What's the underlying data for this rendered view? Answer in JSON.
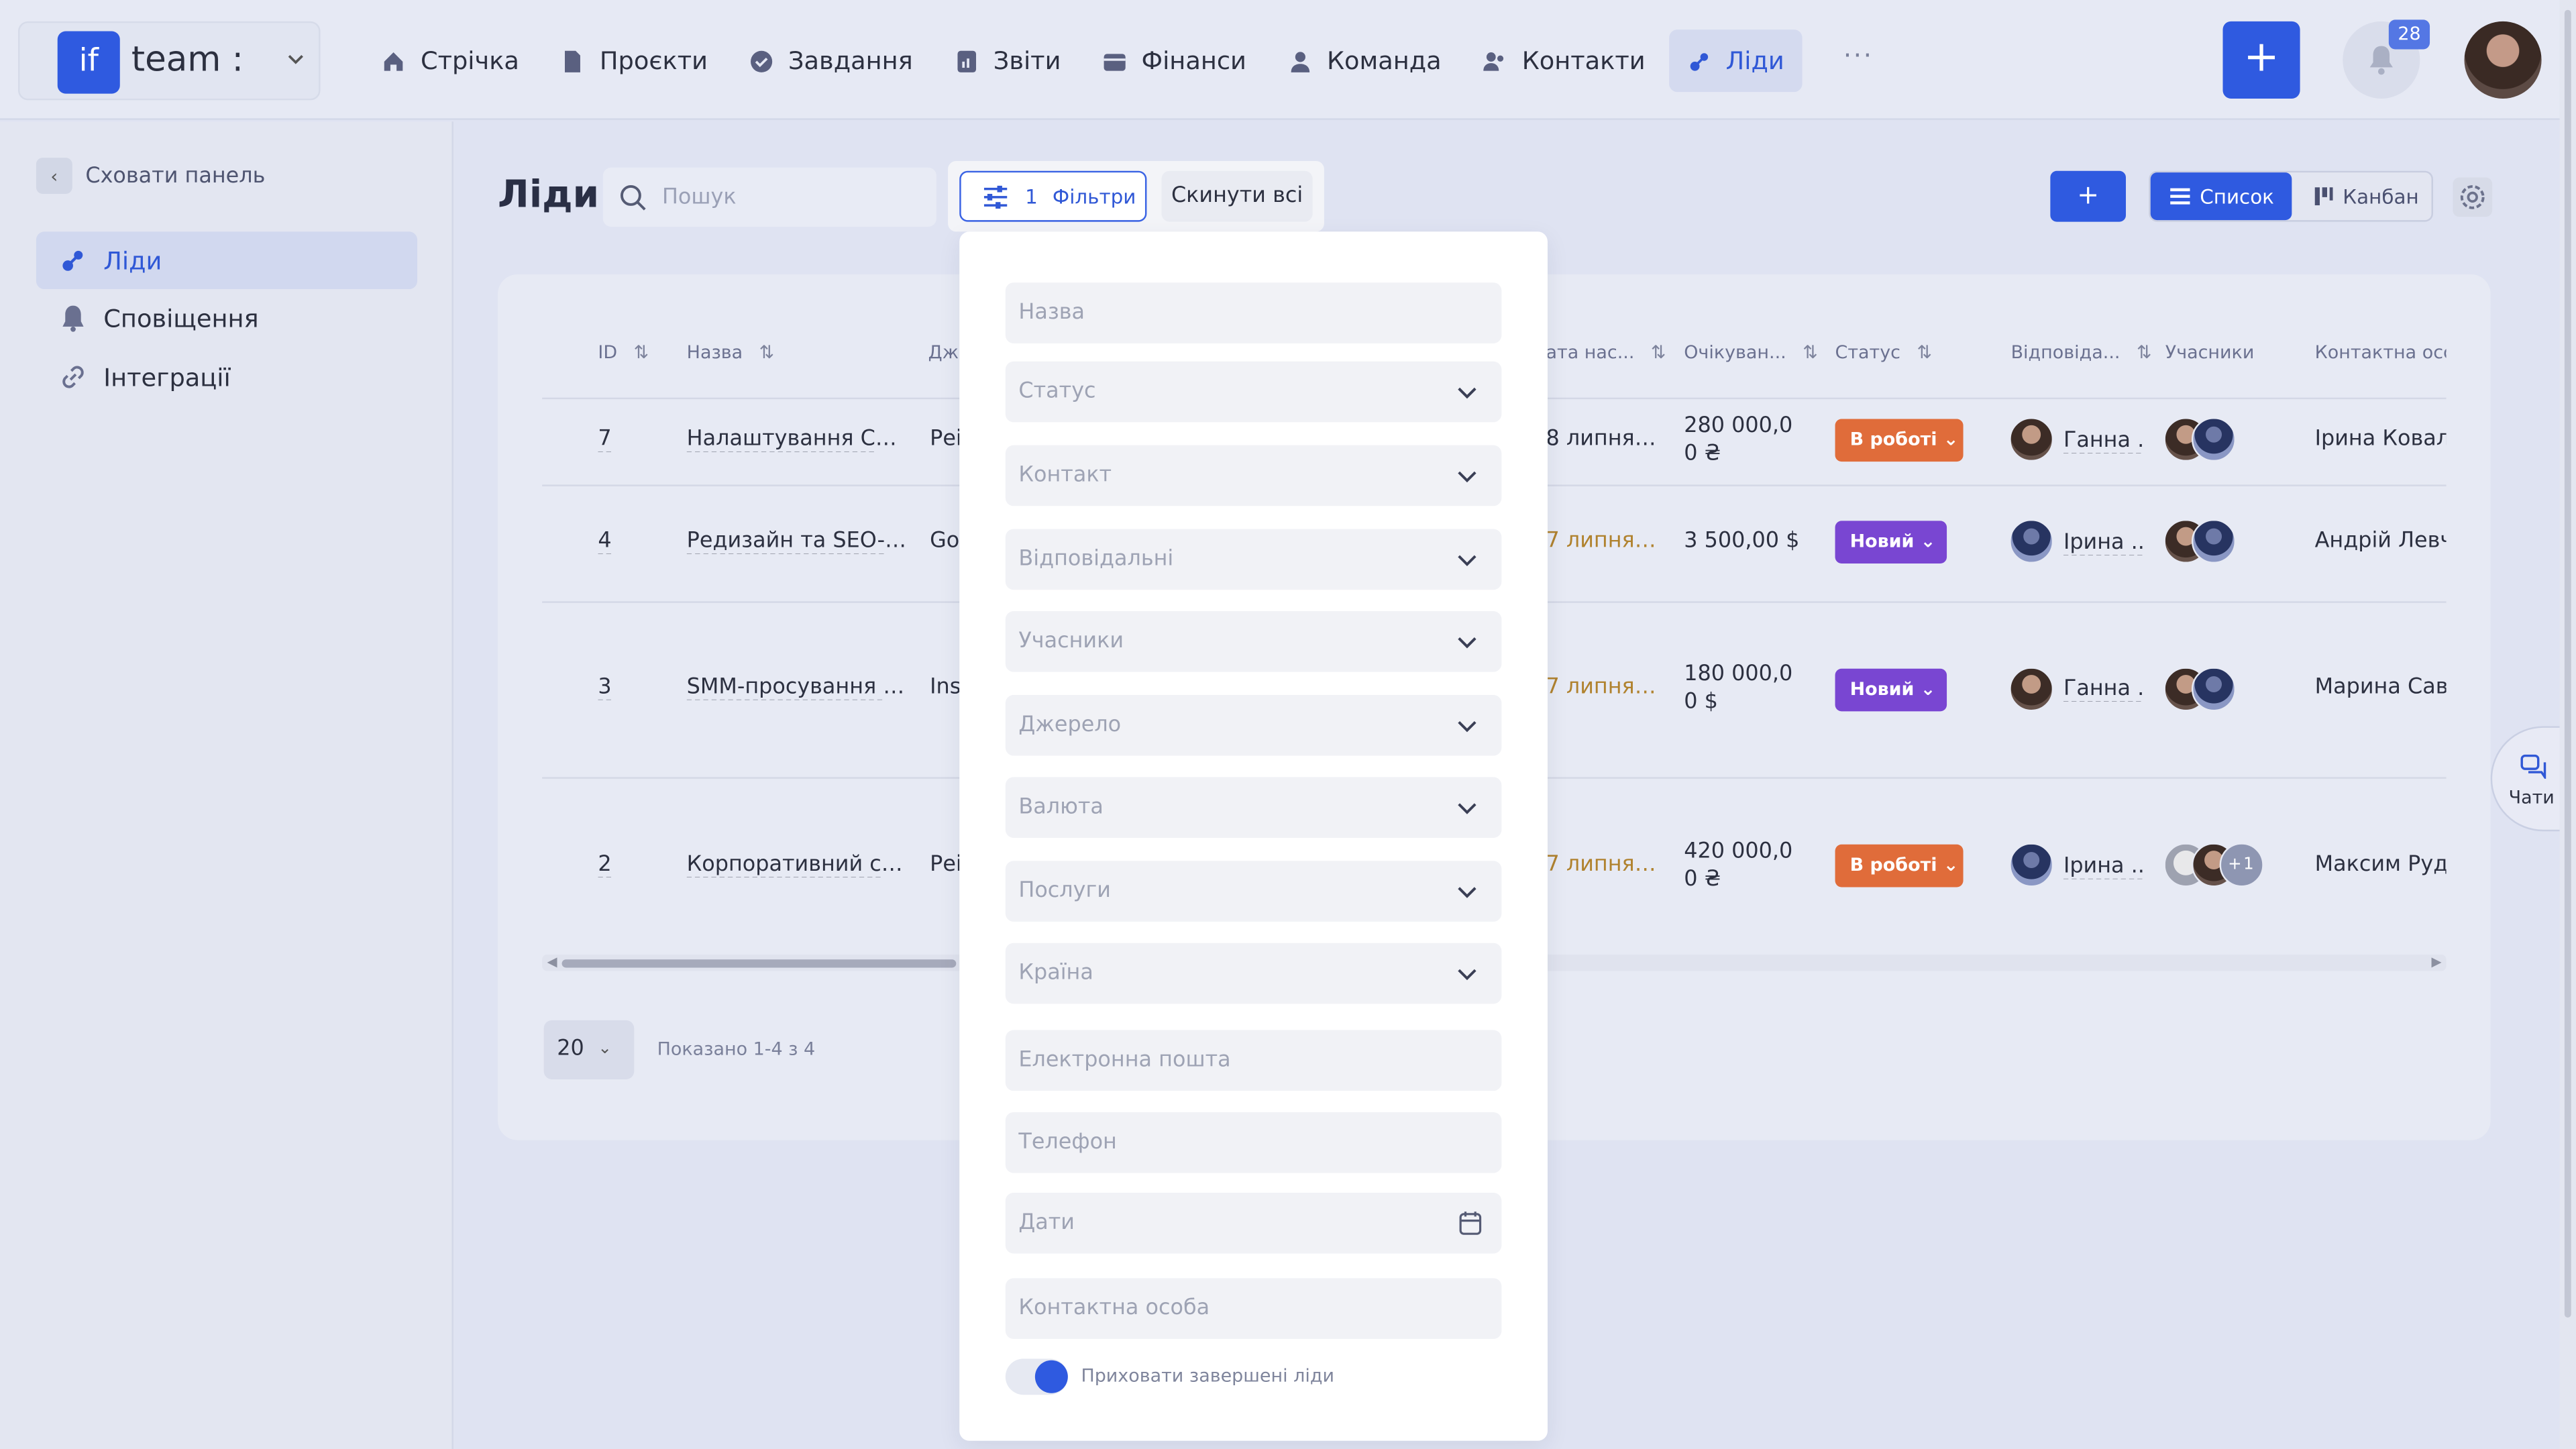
{
  "brand": {
    "logo": "if",
    "name": "team :"
  },
  "nav": [
    {
      "label": "Стрічка",
      "icon": "home-icon"
    },
    {
      "label": "Проєкти",
      "icon": "file-icon"
    },
    {
      "label": "Завдання",
      "icon": "check-circle-icon"
    },
    {
      "label": "Звіти",
      "icon": "report-icon"
    },
    {
      "label": "Фінанси",
      "icon": "wallet-icon"
    },
    {
      "label": "Команда",
      "icon": "person-icon"
    },
    {
      "label": "Контакти",
      "icon": "contacts-icon"
    },
    {
      "label": "Ліди",
      "icon": "leads-icon",
      "active": true
    }
  ],
  "header": {
    "more": "···",
    "add": "+",
    "notifications_count": "28"
  },
  "sidebar": {
    "hide_label": "Сховати панель",
    "items": [
      {
        "label": "Ліди",
        "icon": "leads-icon",
        "active": true
      },
      {
        "label": "Сповіщення",
        "icon": "bell-icon"
      },
      {
        "label": "Інтеграції",
        "icon": "link-icon"
      }
    ]
  },
  "toolbar": {
    "title": "Ліди",
    "search_placeholder": "Пошук",
    "filter_count": "1",
    "filter_label": "Фільтри",
    "reset_label": "Скинути всі",
    "add_label": "+",
    "view_list": "Список",
    "view_kanban": "Канбан"
  },
  "table": {
    "columns": [
      "ID",
      "Назва",
      "Дж",
      "ата нас...",
      "Очікуван...",
      "Статус",
      "Відповіда...",
      "Учасники",
      "Контактна осо"
    ],
    "rows": [
      {
        "id": "7",
        "name": "Налаштування CRM ...",
        "source": "Реі",
        "date": "8 липня, ...",
        "amount1": "280 000,0",
        "amount2": "0 ₴",
        "status": "В роботі",
        "resp": "Ганна ...",
        "contact": "Ірина Коваль"
      },
      {
        "id": "4",
        "name": "Редизайн та SEO-оп...",
        "source": "Goo",
        "date": "7 липня, 2...",
        "amount1": "3 500,00 $",
        "amount2": "",
        "status": "Новий",
        "resp": "Ірина ...",
        "contact": "Андрій Левче"
      },
      {
        "id": "3",
        "name": "SMM-просування ст...",
        "source": "Ins",
        "date": "7 липня, 2...",
        "amount1": "180 000,0",
        "amount2": "0 $",
        "status": "Новий",
        "resp": "Ганна ...",
        "contact": "Марина Савч"
      },
      {
        "id": "2",
        "name": "Корпоративний сай...",
        "source": "Реі",
        "date": "7 липня, 2...",
        "amount1": "420 000,0",
        "amount2": "0 ₴",
        "status": "В роботі",
        "resp": "Ірина ...",
        "contact": "Максим Руде"
      }
    ],
    "participants_more": "+1"
  },
  "pagination": {
    "per_page": "20",
    "shown": "Показано 1-4 з 4"
  },
  "chats": {
    "label": "Чати"
  },
  "filters": {
    "name": "Назва",
    "status": "Статус",
    "contact": "Контакт",
    "responsible": "Відповідальні",
    "participants": "Учасники",
    "source": "Джерело",
    "currency": "Валюта",
    "services": "Послуги",
    "country": "Країна",
    "email": "Електронна пошта",
    "phone": "Телефон",
    "dates": "Дати",
    "contact_person": "Контактна особа",
    "hide_completed": "Приховати завершені ліди"
  },
  "colors": {
    "accent": "#2f5ae0",
    "status_work": "#e06c3a",
    "status_new": "#7946d2"
  }
}
